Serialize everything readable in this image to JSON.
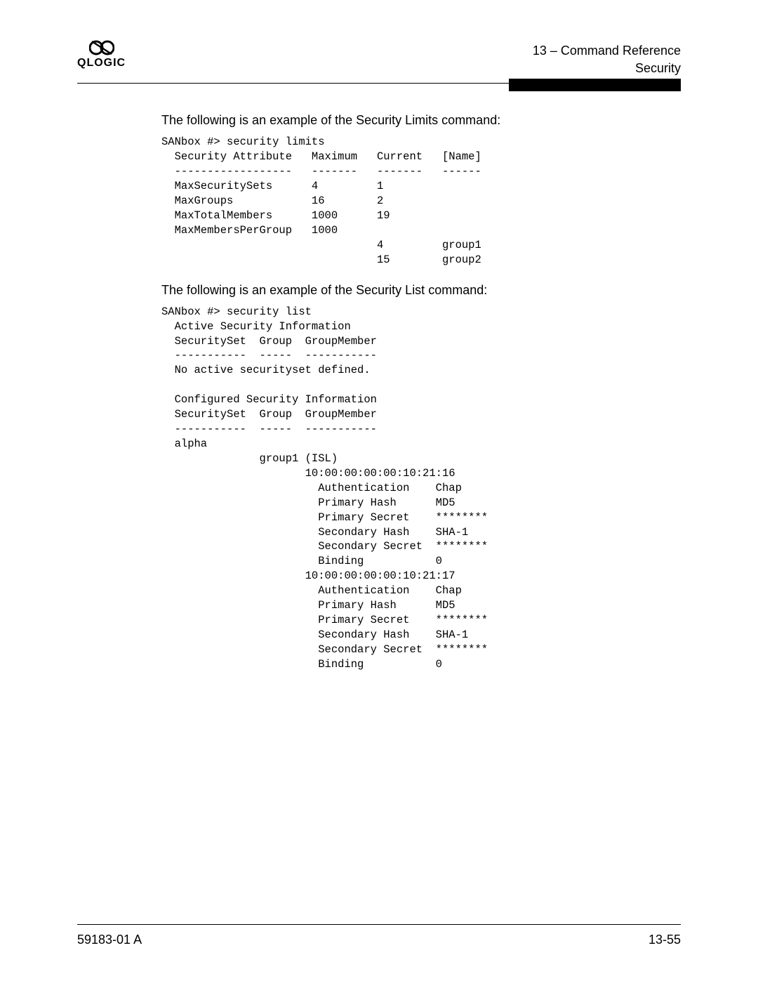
{
  "header": {
    "logo_text": "QLOGIC",
    "chapter": "13 – Command Reference",
    "section": "Security"
  },
  "content": {
    "intro_limits": "The following is an example of the Security Limits command:",
    "code_limits": "SANbox #> security limits\n  Security Attribute   Maximum   Current   [Name]\n  ------------------   -------   -------   ------\n  MaxSecuritySets      4         1\n  MaxGroups            16        2\n  MaxTotalMembers      1000      19\n  MaxMembersPerGroup   1000\n                                 4         group1\n                                 15        group2",
    "intro_list": "The following is an example of the Security List command:",
    "code_list": "SANbox #> security list\n  Active Security Information\n  SecuritySet  Group  GroupMember\n  -----------  -----  -----------\n  No active securityset defined.\n\n  Configured Security Information\n  SecuritySet  Group  GroupMember\n  -----------  -----  -----------\n  alpha\n               group1 (ISL)\n                      10:00:00:00:00:10:21:16\n                        Authentication    Chap\n                        Primary Hash      MD5\n                        Primary Secret    ********\n                        Secondary Hash    SHA-1\n                        Secondary Secret  ********\n                        Binding           0\n                      10:00:00:00:00:10:21:17\n                        Authentication    Chap\n                        Primary Hash      MD5\n                        Primary Secret    ********\n                        Secondary Hash    SHA-1\n                        Secondary Secret  ********\n                        Binding           0"
  },
  "footer": {
    "doc_id": "59183-01 A",
    "page": "13-55"
  }
}
